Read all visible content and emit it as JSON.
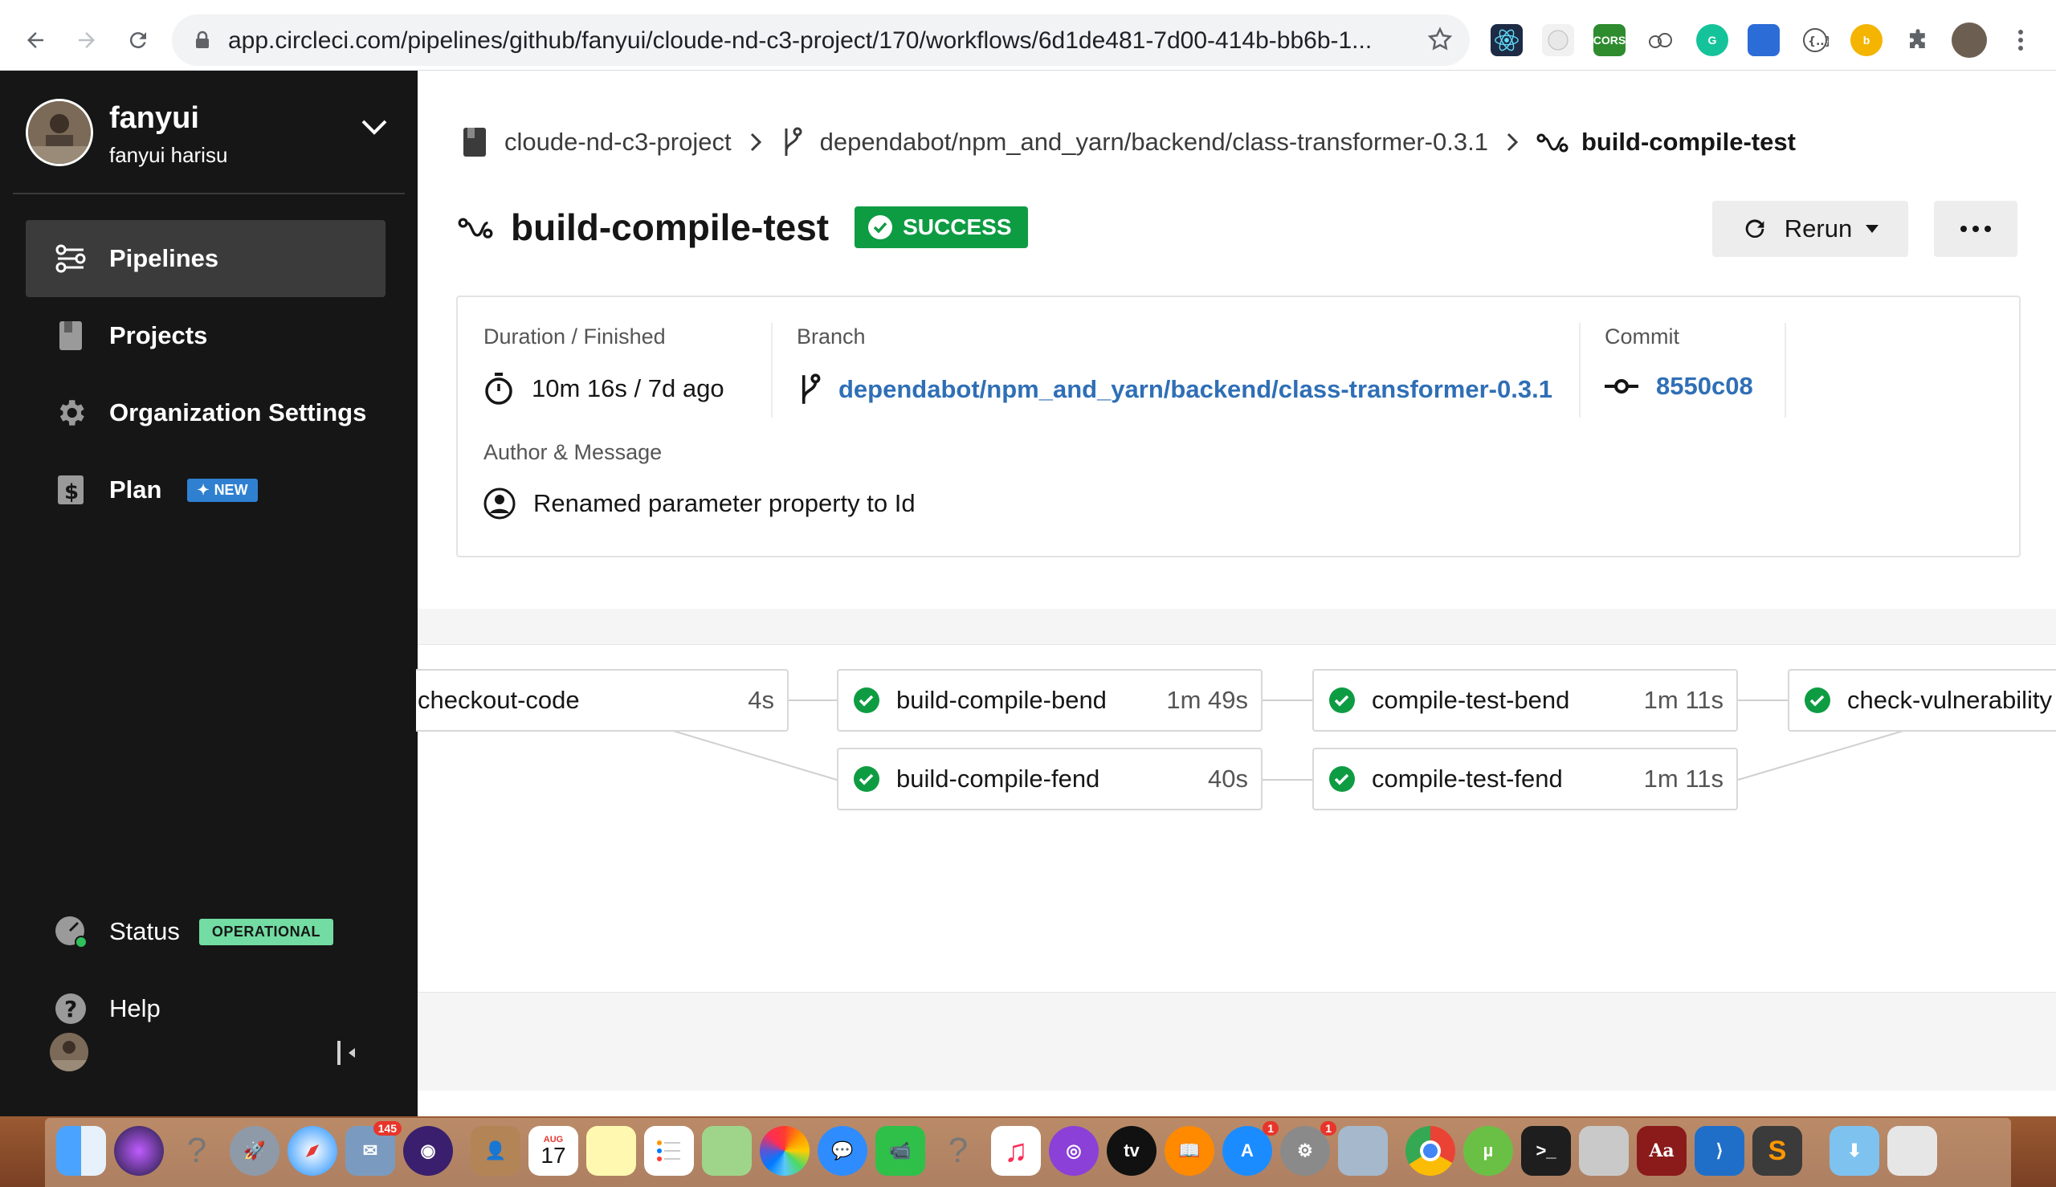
{
  "browser": {
    "url": "app.circleci.com/pipelines/github/fanyui/cloude-nd-c3-project/170/workflows/6d1de481-7d00-414b-bb6b-1...",
    "ext_cors": "CORS"
  },
  "sidebar": {
    "username": "fanyui",
    "fullname": "fanyui harisu",
    "items": [
      {
        "label": "Pipelines"
      },
      {
        "label": "Projects"
      },
      {
        "label": "Organization Settings"
      },
      {
        "label": "Plan",
        "badge": "NEW"
      }
    ],
    "status_label": "Status",
    "status_badge": "OPERATIONAL",
    "help_label": "Help"
  },
  "breadcrumb": {
    "project": "cloude-nd-c3-project",
    "branch": "dependabot/npm_and_yarn/backend/class-transformer-0.3.1",
    "workflow": "build-compile-test"
  },
  "header": {
    "title": "build-compile-test",
    "status": "SUCCESS",
    "rerun_label": "Rerun"
  },
  "details": {
    "duration_label": "Duration / Finished",
    "duration_value": "10m 16s / 7d ago",
    "branch_label": "Branch",
    "branch_value": "dependabot/npm_and_yarn/backend/class-transformer-0.3.1",
    "commit_label": "Commit",
    "commit_value": "8550c08",
    "author_label": "Author & Message",
    "message": "Renamed parameter property to Id"
  },
  "jobs": [
    {
      "name": "checkout-code",
      "duration": "4s",
      "status": "success"
    },
    {
      "name": "build-compile-bend",
      "duration": "1m 49s",
      "status": "success"
    },
    {
      "name": "build-compile-fend",
      "duration": "40s",
      "status": "success"
    },
    {
      "name": "compile-test-bend",
      "duration": "1m 11s",
      "status": "success"
    },
    {
      "name": "compile-test-fend",
      "duration": "1m 11s",
      "status": "success"
    },
    {
      "name": "check-vulnerability",
      "duration": "",
      "status": "success"
    }
  ],
  "dock": {
    "calendar_month": "AUG",
    "calendar_day": "17",
    "mail_badge": "145",
    "appstore_badge": "1",
    "prefs_badge": "1",
    "tv_label": "tv",
    "dict_label": "Aa"
  },
  "colors": {
    "sidebar_bg": "#161616",
    "success_green": "#0e9c43",
    "link_blue": "#2f6fb6",
    "new_badge": "#2f80d1",
    "operational_badge": "#72dca2"
  }
}
